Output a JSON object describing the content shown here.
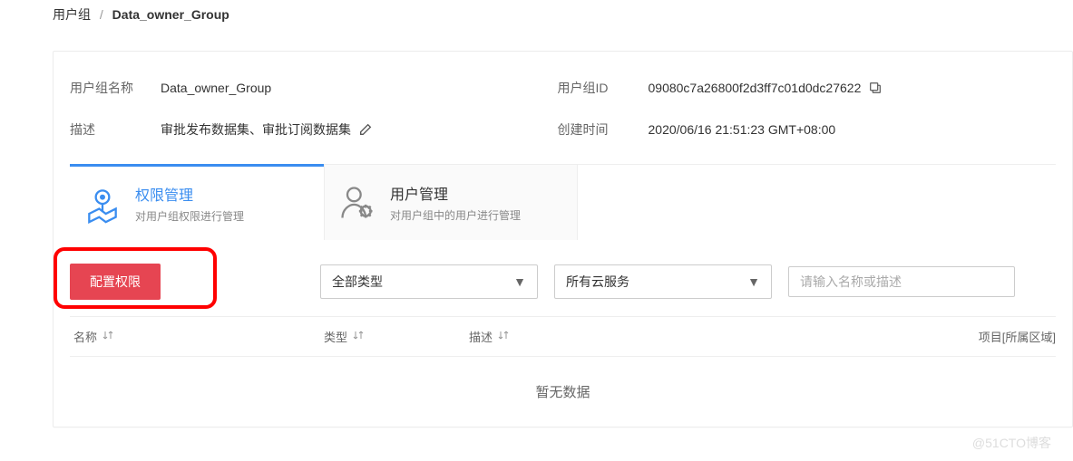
{
  "breadcrumb": {
    "parent": "用户组",
    "current": "Data_owner_Group"
  },
  "info": {
    "name_label": "用户组名称",
    "name_value": "Data_owner_Group",
    "id_label": "用户组ID",
    "id_value": "09080c7a26800f2d3ff7c01d0dc27622",
    "desc_label": "描述",
    "desc_value": "审批发布数据集、审批订阅数据集",
    "created_label": "创建时间",
    "created_value": "2020/06/16 21:51:23 GMT+08:00"
  },
  "tabs": {
    "perm": {
      "title": "权限管理",
      "subtitle": "对用户组权限进行管理"
    },
    "user": {
      "title": "用户管理",
      "subtitle": "对用户组中的用户进行管理"
    }
  },
  "toolbar": {
    "config_btn": "配置权限",
    "type_select": "全部类型",
    "service_select": "所有云服务",
    "search_placeholder": "请输入名称或描述"
  },
  "columns": {
    "name": "名称",
    "type": "类型",
    "desc": "描述",
    "project": "项目[所属区域]"
  },
  "empty_text": "暂无数据",
  "watermark": "@51CTO博客"
}
